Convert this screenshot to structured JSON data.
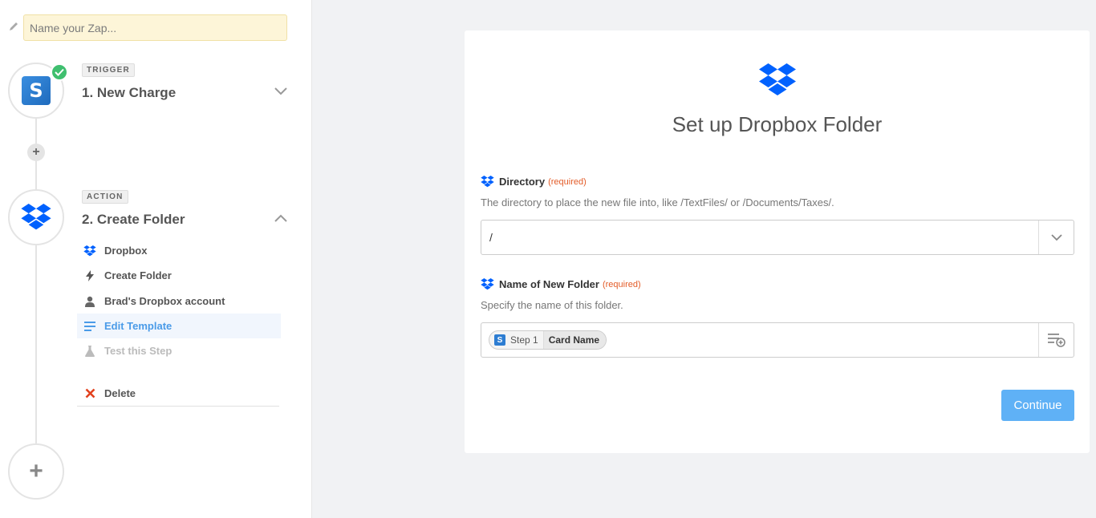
{
  "sidebar": {
    "zap_name_placeholder": "Name your Zap...",
    "trigger": {
      "tag": "TRIGGER",
      "title": "1. New Charge",
      "app_letter": "S"
    },
    "action": {
      "tag": "ACTION",
      "title": "2. Create Folder",
      "items": [
        {
          "label": "Dropbox",
          "icon": "dropbox-icon"
        },
        {
          "label": "Create Folder",
          "icon": "bolt-icon"
        },
        {
          "label": "Brad's Dropbox account",
          "icon": "user-icon"
        },
        {
          "label": "Edit Template",
          "icon": "list-icon",
          "active": true
        },
        {
          "label": "Test this Step",
          "icon": "flask-icon",
          "disabled": true
        }
      ],
      "delete_label": "Delete"
    }
  },
  "main": {
    "title": "Set up Dropbox Folder",
    "directory": {
      "label": "Directory",
      "required": "(required)",
      "help": "The directory to place the new file into, like /TextFiles/ or /Documents/Taxes/.",
      "value": "/"
    },
    "folder_name": {
      "label": "Name of New Folder",
      "required": "(required)",
      "help": "Specify the name of this folder.",
      "pill_app": "S",
      "pill_step": "Step 1",
      "pill_field": "Card Name"
    },
    "continue_label": "Continue"
  },
  "colors": {
    "dropbox_blue": "#0061fe",
    "accent": "#5fb1f6",
    "required": "#e35b27",
    "success": "#3fbf6f"
  }
}
